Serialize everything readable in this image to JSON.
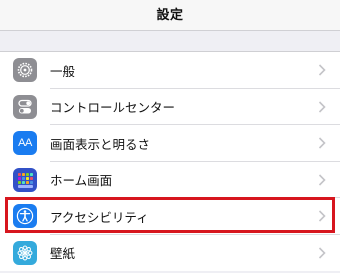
{
  "header": {
    "title": "設定"
  },
  "settings": {
    "items": [
      {
        "label": "一般",
        "icon": "gear-icon",
        "color": "#8e8e93"
      },
      {
        "label": "コントロールセンター",
        "icon": "toggles-icon",
        "color": "#8e8e93"
      },
      {
        "label": "画面表示と明るさ",
        "icon": "text-size-icon",
        "color": "#1a7cf0",
        "glyph": "AA"
      },
      {
        "label": "ホーム画面",
        "icon": "app-grid-icon",
        "color": "#3251c7"
      },
      {
        "label": "アクセシビリティ",
        "icon": "accessibility-icon",
        "color": "#1a7cf0"
      },
      {
        "label": "壁紙",
        "icon": "flower-icon",
        "color": "#34aadc"
      }
    ]
  },
  "highlight": {
    "color": "#d7161e",
    "target": "アクセシビリティ"
  }
}
